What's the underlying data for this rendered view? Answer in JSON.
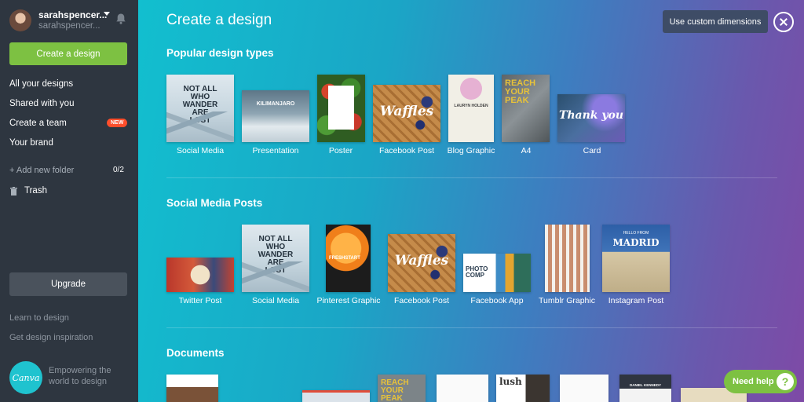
{
  "user": {
    "name": "sarahspencer...",
    "email": "sarahspencer..."
  },
  "sidebar": {
    "create_label": "Create a design",
    "nav": [
      "All your designs",
      "Shared with you",
      "Create a team",
      "Your brand"
    ],
    "new_badge": "NEW",
    "add_folder": "+ Add new folder",
    "folder_count": "0/2",
    "trash": "Trash",
    "upgrade": "Upgrade",
    "learn": "Learn to design",
    "inspiration": "Get design inspiration",
    "logo_text": "Canva",
    "tagline": "Empowering the world to design"
  },
  "main": {
    "title": "Create a design",
    "custom_dimensions": "Use custom dimensions",
    "sections": [
      {
        "title": "Popular design types",
        "items": [
          "Social Media",
          "Presentation",
          "Poster",
          "Facebook Post",
          "Blog Graphic",
          "A4",
          "Card"
        ]
      },
      {
        "title": "Social Media Posts",
        "items": [
          "Twitter Post",
          "Social Media",
          "Pinterest Graphic",
          "Facebook Post",
          "Facebook App",
          "Tumblr Graphic",
          "Instagram Post"
        ]
      },
      {
        "title": "Documents",
        "items": []
      }
    ]
  },
  "thumb_text": {
    "not_all": "NOT ALL WHO WANDER ARE LOST",
    "kilimanjaro": "KILIMANJARO",
    "waffles": "Waffles",
    "lauryn": "LAURYN HOLDEN",
    "reach": "REACH YOUR PEAK",
    "thank_you": "Thank you",
    "freshstart": "FRESHSTART",
    "photo_comp": "PHOTO COMP",
    "hello_from": "HELLO FROM",
    "madrid": "MADRID",
    "lush": "lush",
    "daniel": "DANIEL KENNEDY"
  },
  "help": {
    "label": "Need help",
    "icon": "?"
  },
  "colors": {
    "accent_green": "#7dc142",
    "sidebar_bg": "#2e3640",
    "new_badge": "#ff4e2b"
  }
}
